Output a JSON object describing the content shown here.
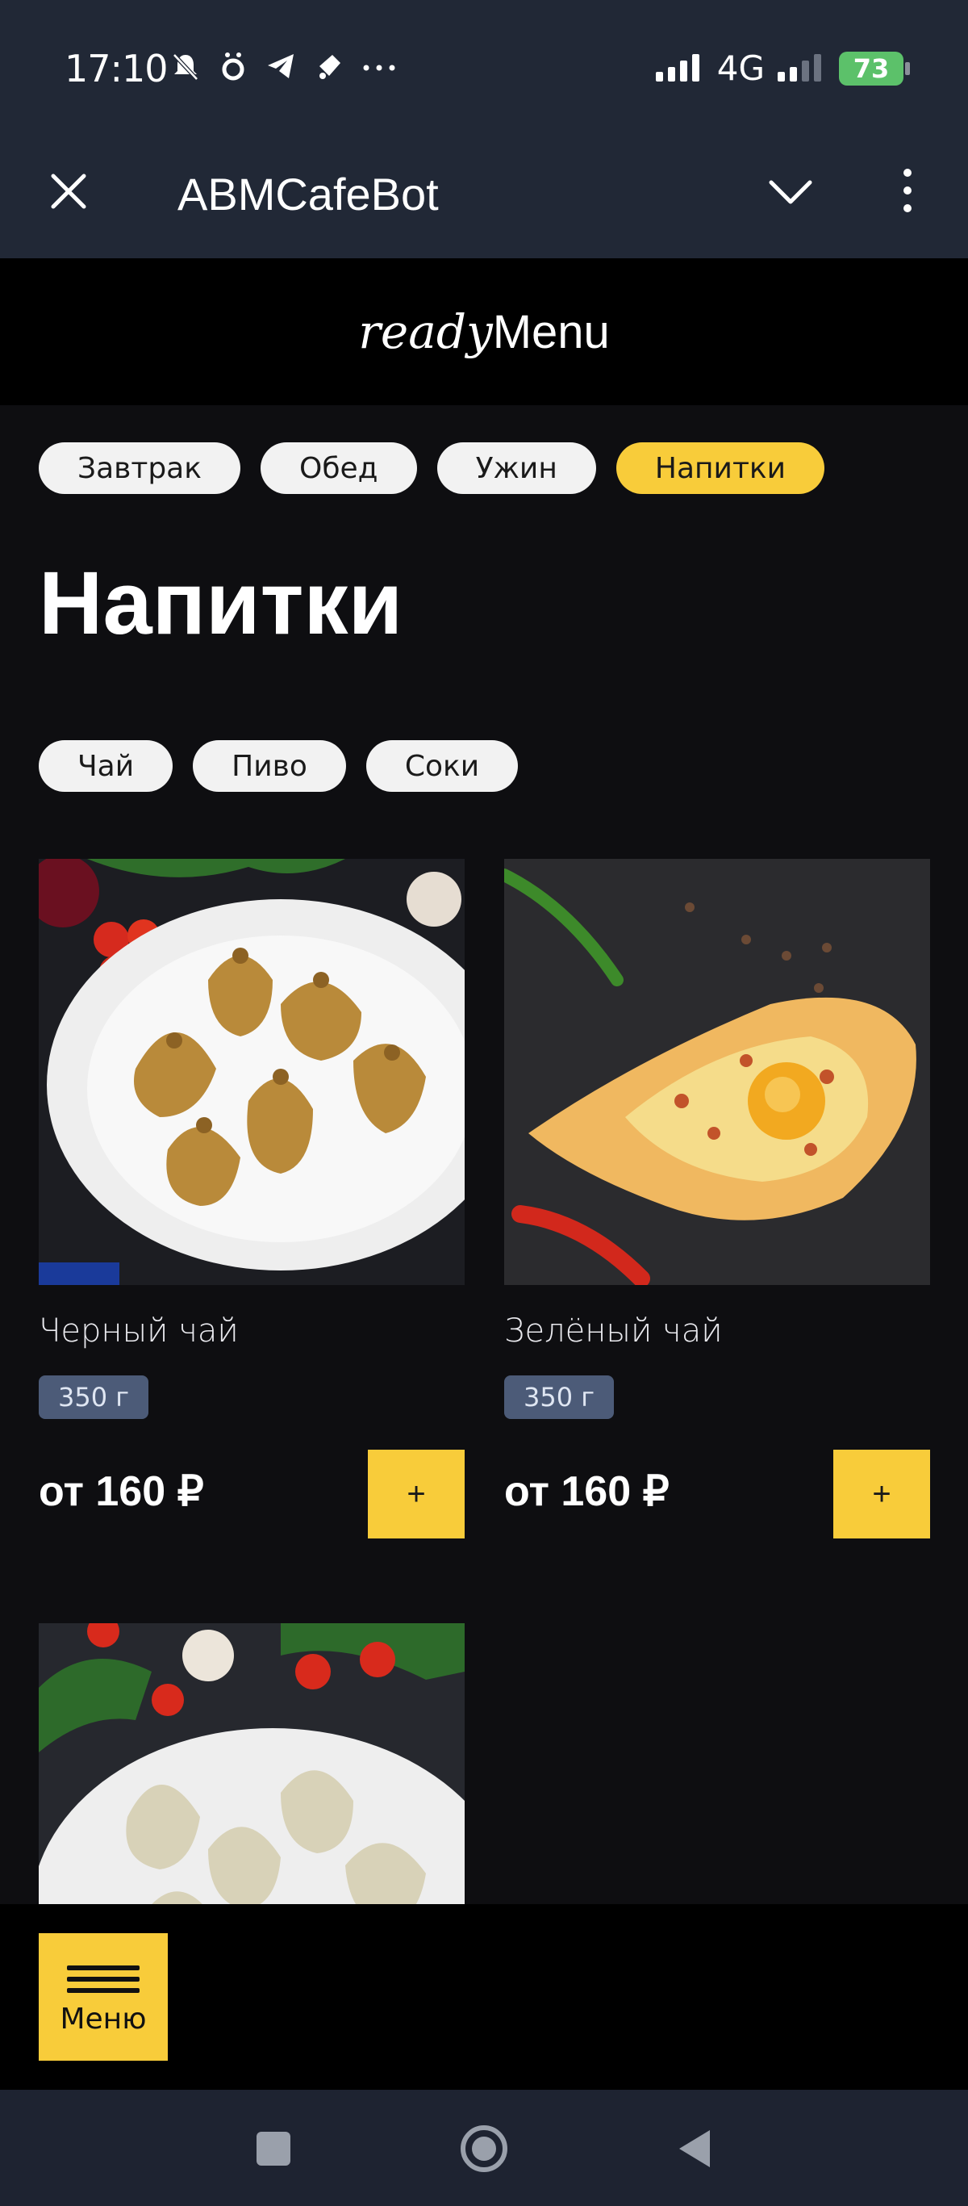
{
  "status_bar": {
    "time": "17:10",
    "network": "4G",
    "battery": "73",
    "icons": [
      "mute-icon",
      "app-notification-icon",
      "telegram-icon",
      "send-icon",
      "more-notifications-icon",
      "signal-icon",
      "signal-icon-2",
      "battery-icon"
    ]
  },
  "header": {
    "title": "ABMCafeBot"
  },
  "brand": {
    "ready": "ready",
    "menu": "Menu"
  },
  "categories": [
    {
      "label": "Завтрак",
      "active": false
    },
    {
      "label": "Обед",
      "active": false
    },
    {
      "label": "Ужин",
      "active": false
    },
    {
      "label": "Напитки",
      "active": true
    }
  ],
  "page": {
    "title": "Напитки"
  },
  "subcategories": [
    "Чай",
    "Пиво",
    "Соки"
  ],
  "products": [
    {
      "name": "Черный чай",
      "weight": "350 г",
      "price": "от 160 ₽",
      "add_label": "+"
    },
    {
      "name": "Зелёный чай",
      "weight": "350 г",
      "price": "от 160 ₽",
      "add_label": "+"
    }
  ],
  "menu_button": {
    "label": "Меню"
  },
  "colors": {
    "accent": "#f8cc3a",
    "header_bg": "#212836",
    "content_bg": "#0e0e11",
    "badge_bg": "#4c5b78",
    "battery": "#5cc16a"
  }
}
